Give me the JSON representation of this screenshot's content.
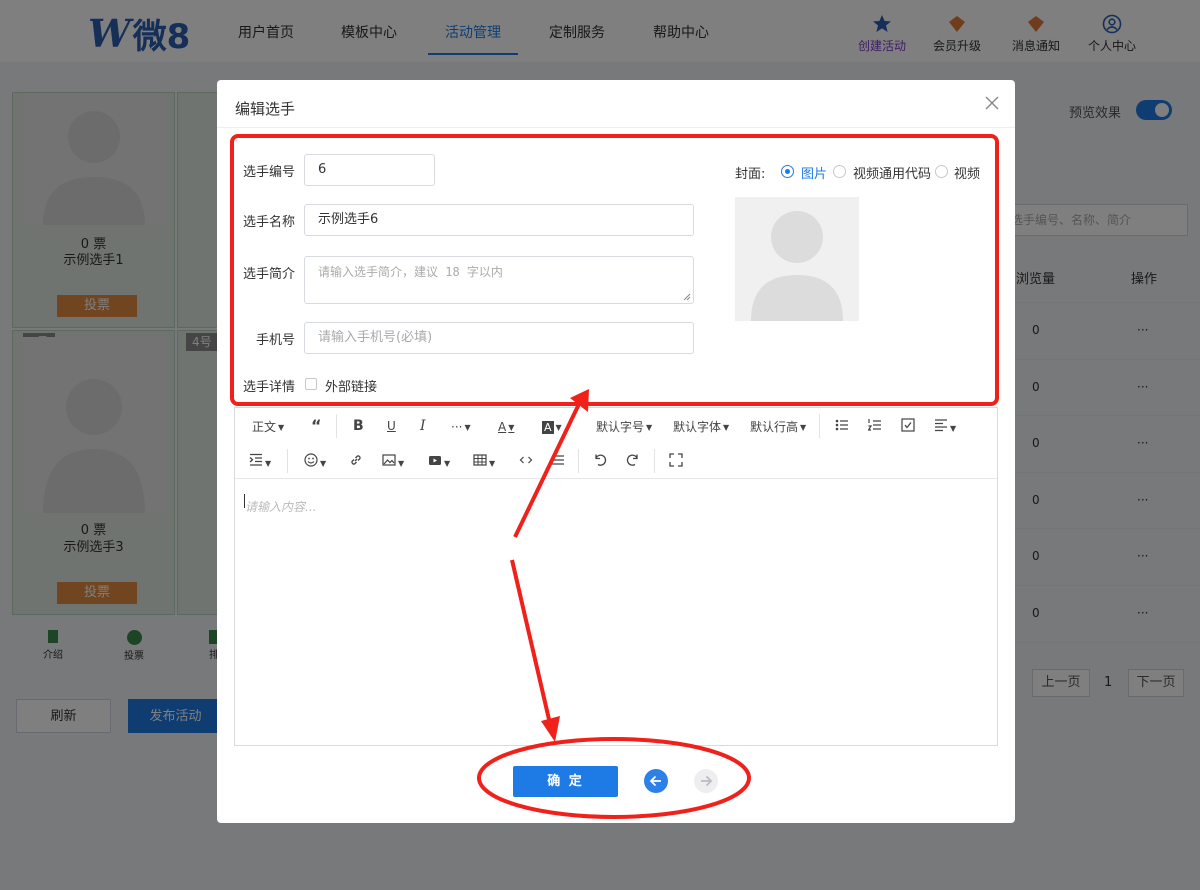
{
  "nav": {
    "logo_letter": "W",
    "logo_text": "微8",
    "items": [
      "用户首页",
      "模板中心",
      "活动管理",
      "定制服务",
      "帮助中心"
    ],
    "active_index": 2,
    "right_icons": [
      {
        "label": "创建活动",
        "icon": "star-icon"
      },
      {
        "label": "会员升级",
        "icon": "crown-icon"
      },
      {
        "label": "消息通知",
        "icon": "bell-icon"
      },
      {
        "label": "个人中心",
        "icon": "user-icon"
      }
    ]
  },
  "background": {
    "cards": [
      {
        "votes": "0 票",
        "name": "示例选手1",
        "vote_button": "投票"
      },
      {
        "tag": "3号",
        "votes": "0 票",
        "name": "示例选手3",
        "vote_button": "投票"
      }
    ],
    "second_card_tag": "4号",
    "bottom_nav": [
      {
        "label": "介绍",
        "icon": "bookmark-icon"
      },
      {
        "label": "投票",
        "icon": "vote-icon"
      },
      {
        "label": "排",
        "icon": "rank-icon"
      }
    ],
    "refresh_button": "刷新",
    "publish_button": "发布活动",
    "preview_label": "预览效果",
    "search_placeholder": "选手编号、名称、简介",
    "col_views": "浏览量",
    "col_actions": "操作",
    "row_values": [
      "0",
      "0",
      "0",
      "0",
      "0",
      "0"
    ],
    "row_action": "···",
    "pager": {
      "prev": "上一页",
      "page": "1",
      "next": "下一页"
    }
  },
  "modal": {
    "title": "编辑选手",
    "fields": {
      "number_label": "选手编号",
      "number_value": "6",
      "name_label": "选手名称",
      "name_value": "示例选手6",
      "intro_label": "选手简介",
      "intro_placeholder": "请输入选手简介，建议 18 字以内",
      "phone_label": "手机号",
      "phone_placeholder": "请输入手机号(必填)",
      "detail_label": "选手详情",
      "external_link_label": "外部链接"
    },
    "cover": {
      "label": "封面:",
      "options": [
        "图片",
        "视频通用代码",
        "视频"
      ],
      "selected_index": 0
    },
    "toolbar": {
      "row1": [
        "正文",
        "“",
        "B",
        "U",
        "I",
        "···",
        "A",
        "A",
        "默认字号",
        "默认字体",
        "默认行高"
      ],
      "row2_icons": [
        "indent-icon",
        "emoji-icon",
        "link-icon",
        "image-icon",
        "video-icon",
        "table-icon",
        "code-icon",
        "divider-icon",
        "undo-icon",
        "redo-icon",
        "fullscreen-icon"
      ]
    },
    "editor_placeholder": "请输入内容...",
    "confirm_button": "确 定"
  },
  "colors": {
    "accent": "#1e7be5",
    "annotation": "#f0211a",
    "vote_button": "#e08a3e"
  }
}
